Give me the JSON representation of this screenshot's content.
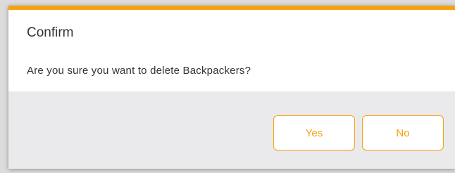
{
  "dialog": {
    "title": "Confirm",
    "message": "Are you sure you want to delete Backpackers?",
    "yes_label": "Yes",
    "no_label": "No"
  },
  "colors": {
    "accent": "#f7a10e",
    "footer": "#eaeaed"
  }
}
